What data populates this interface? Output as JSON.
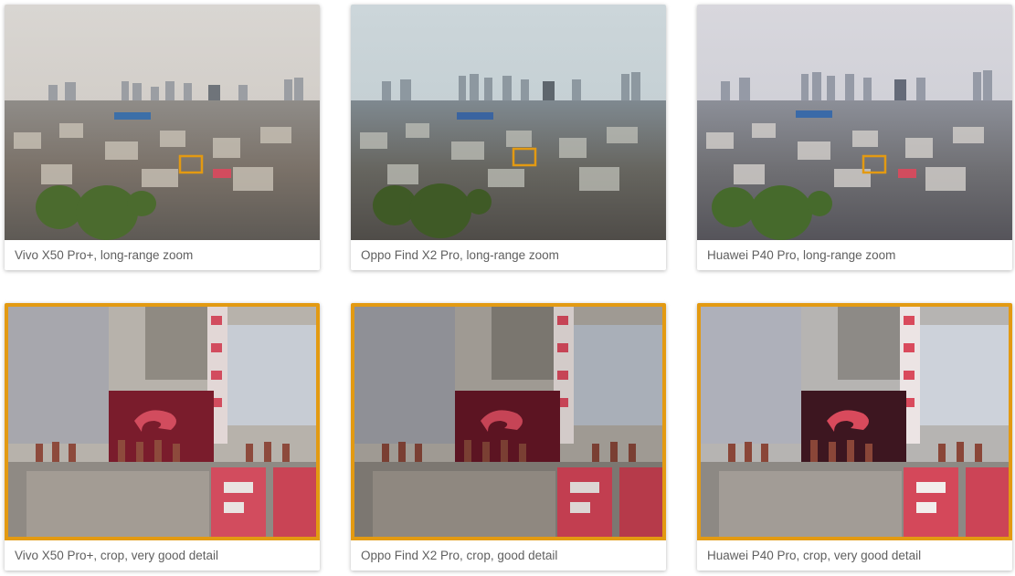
{
  "accent_color": "#e39a12",
  "cards": {
    "vivo_zoom": {
      "caption": "Vivo X50 Pro+, long-range zoom",
      "image": "paris-skyline-zoom-photo"
    },
    "oppo_zoom": {
      "caption": "Oppo Find X2 Pro, long-range zoom",
      "image": "paris-skyline-zoom-photo"
    },
    "huawei_zoom": {
      "caption": "Huawei P40 Pro, long-range zoom",
      "image": "paris-skyline-zoom-photo"
    },
    "vivo_crop": {
      "caption": "Vivo X50 Pro+, crop, very good detail",
      "image": "rooftop-chimney-crop-photo"
    },
    "oppo_crop": {
      "caption": "Oppo Find X2 Pro, crop, good detail",
      "image": "rooftop-chimney-crop-photo"
    },
    "huawei_crop": {
      "caption": "Huawei P40 Pro, crop, very good detail",
      "image": "rooftop-chimney-crop-photo"
    }
  }
}
